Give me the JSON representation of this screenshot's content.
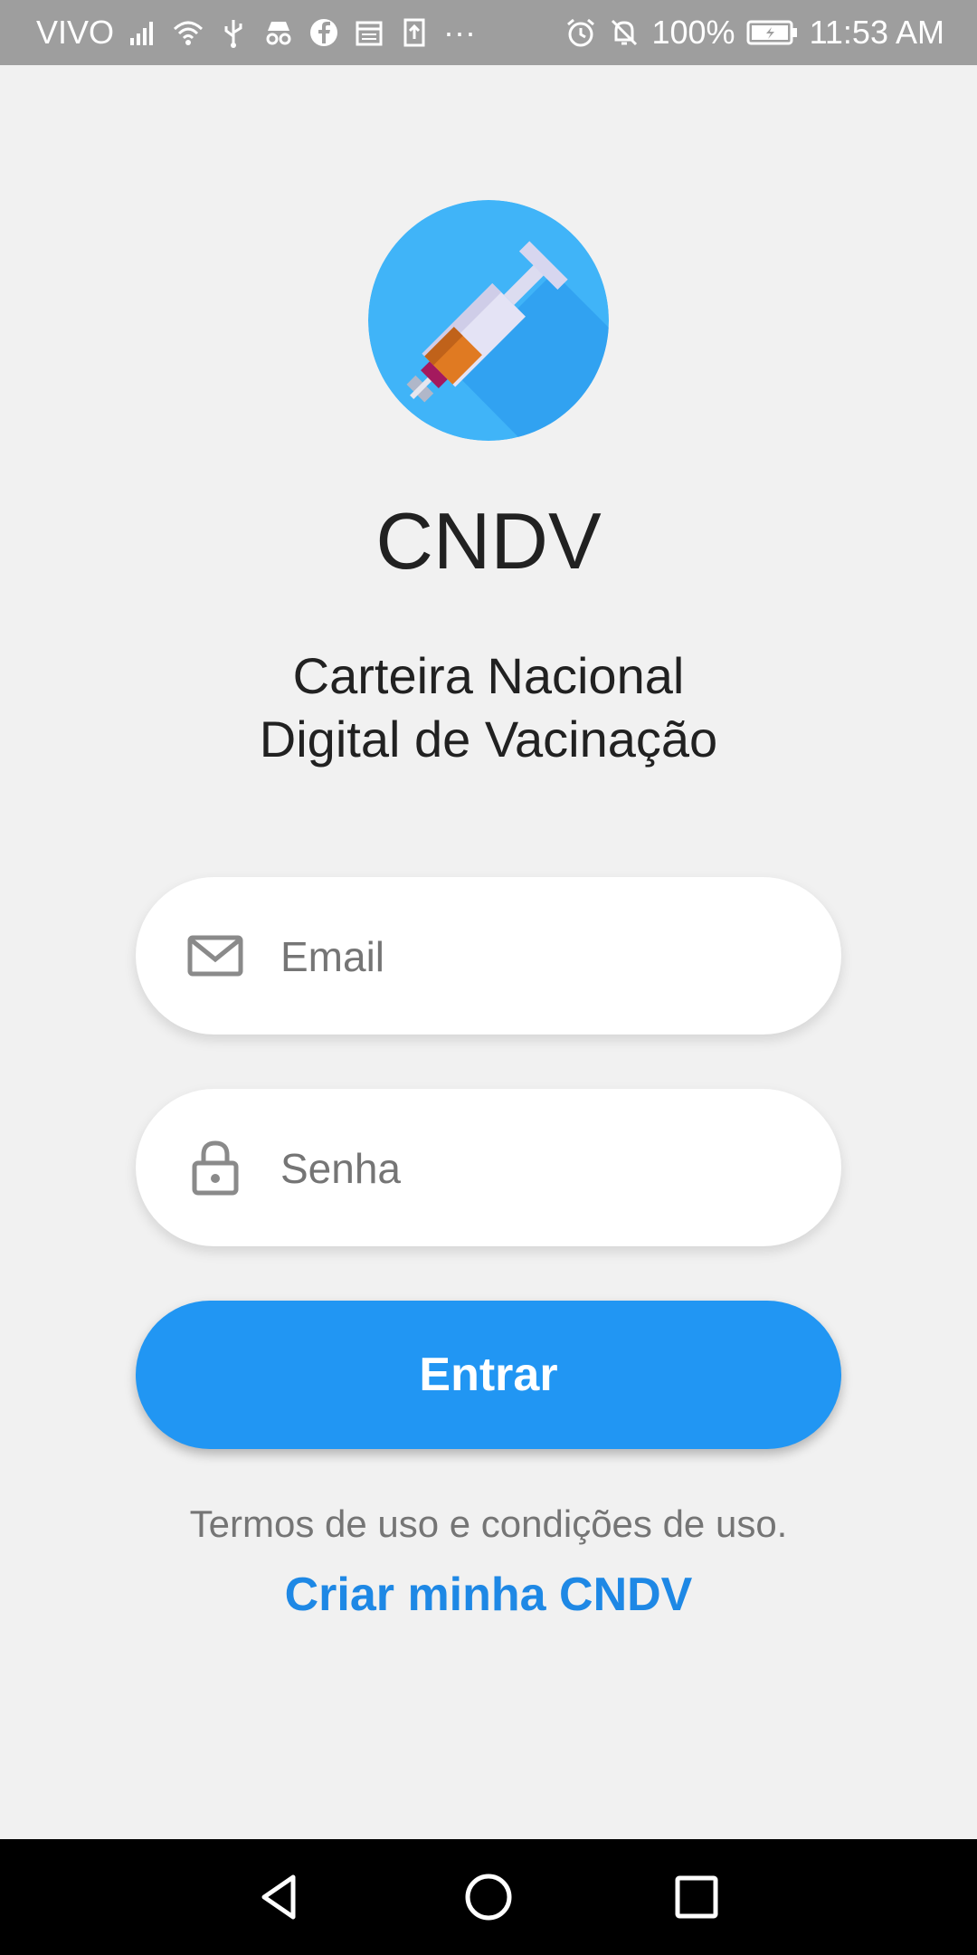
{
  "status_bar": {
    "carrier": "VIVO",
    "battery": "100%",
    "time": "11:53 AM",
    "icons": [
      "signal-icon",
      "wifi-icon",
      "usb-icon",
      "incognito-icon",
      "facebook-icon",
      "calendar-icon",
      "upload-icon",
      "more-icon",
      "alarm-icon",
      "mute-icon",
      "battery-icon"
    ]
  },
  "app": {
    "title": "CNDV",
    "subtitle_line1": "Carteira Nacional",
    "subtitle_line2": "Digital de Vacinação",
    "logo_icon": "syringe-icon"
  },
  "form": {
    "email_placeholder": "Email",
    "email_value": "",
    "password_placeholder": "Senha",
    "password_value": "",
    "login_label": "Entrar"
  },
  "links": {
    "terms": "Termos de uso e condições de uso.",
    "create": "Criar minha CNDV"
  },
  "colors": {
    "primary": "#2196f3",
    "link": "#1e88e5",
    "background": "#f1f1f1",
    "status_bar": "#9e9e9e"
  },
  "nav_bar": {
    "icons": [
      "back-icon",
      "home-icon",
      "recents-icon"
    ]
  }
}
